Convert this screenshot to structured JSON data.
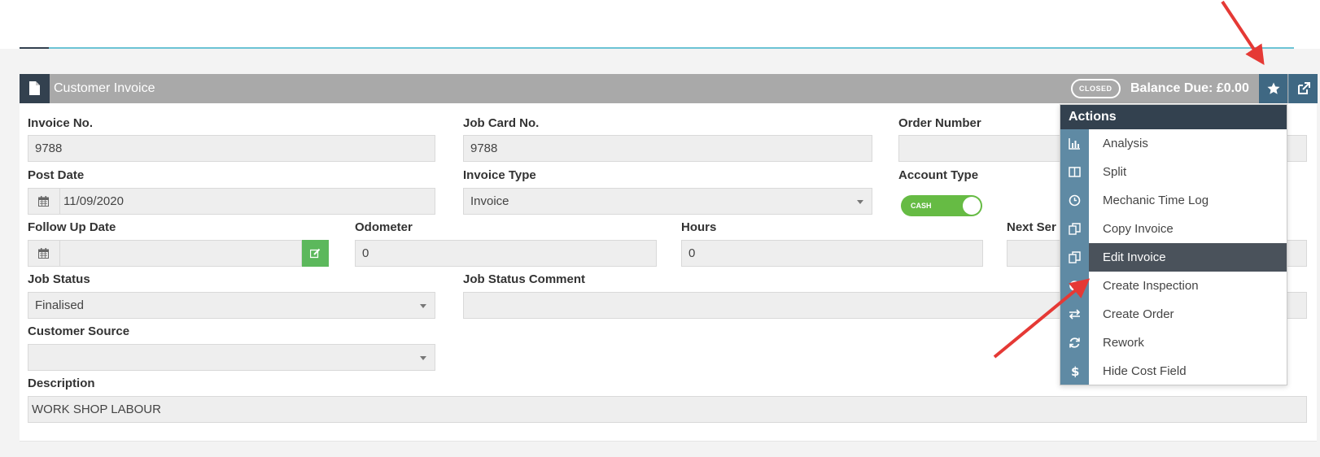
{
  "panel": {
    "title": "Customer Invoice",
    "status_badge": "CLOSED",
    "balance": "Balance Due: £0.00"
  },
  "fields": {
    "invoice_no": {
      "label": "Invoice No.",
      "value": "9788"
    },
    "job_card_no": {
      "label": "Job Card No.",
      "value": "9788"
    },
    "order_number": {
      "label": "Order Number",
      "value": ""
    },
    "post_date": {
      "label": "Post Date",
      "value": "11/09/2020"
    },
    "invoice_type": {
      "label": "Invoice Type",
      "value": "Invoice"
    },
    "account_type": {
      "label": "Account Type",
      "value": "CASH"
    },
    "follow_up_date": {
      "label": "Follow Up Date",
      "value": ""
    },
    "odometer": {
      "label": "Odometer",
      "value": "0"
    },
    "hours": {
      "label": "Hours",
      "value": "0"
    },
    "next_service": {
      "label": "Next Ser",
      "value": ""
    },
    "job_status": {
      "label": "Job Status",
      "value": "Finalised"
    },
    "job_status_comment": {
      "label": "Job Status Comment",
      "value": ""
    },
    "customer_source": {
      "label": "Customer Source",
      "value": ""
    },
    "description": {
      "label": "Description",
      "value": "WORK SHOP LABOUR"
    }
  },
  "actions_menu": {
    "title": "Actions",
    "items": [
      {
        "label": "Analysis",
        "icon": "bar-chart-icon"
      },
      {
        "label": "Split",
        "icon": "columns-icon"
      },
      {
        "label": "Mechanic Time Log",
        "icon": "clock-icon"
      },
      {
        "label": "Copy Invoice",
        "icon": "copy-icon"
      },
      {
        "label": "Edit Invoice",
        "icon": "copy-icon",
        "active": true
      },
      {
        "label": "Create Inspection",
        "icon": "circle-icon"
      },
      {
        "label": "Create Order",
        "icon": "exchange-icon"
      },
      {
        "label": "Rework",
        "icon": "refresh-icon"
      },
      {
        "label": "Hide Cost Field",
        "icon": "dollar-icon"
      }
    ]
  },
  "colors": {
    "header_gray": "#a9a9a9",
    "header_dark": "#33414f",
    "header_blue": "#3f6883",
    "menu_icon_column": "#5f8aa4",
    "active_item": "#4a525b",
    "toggle_green": "#66bb44",
    "annotation_red": "#e53935"
  }
}
